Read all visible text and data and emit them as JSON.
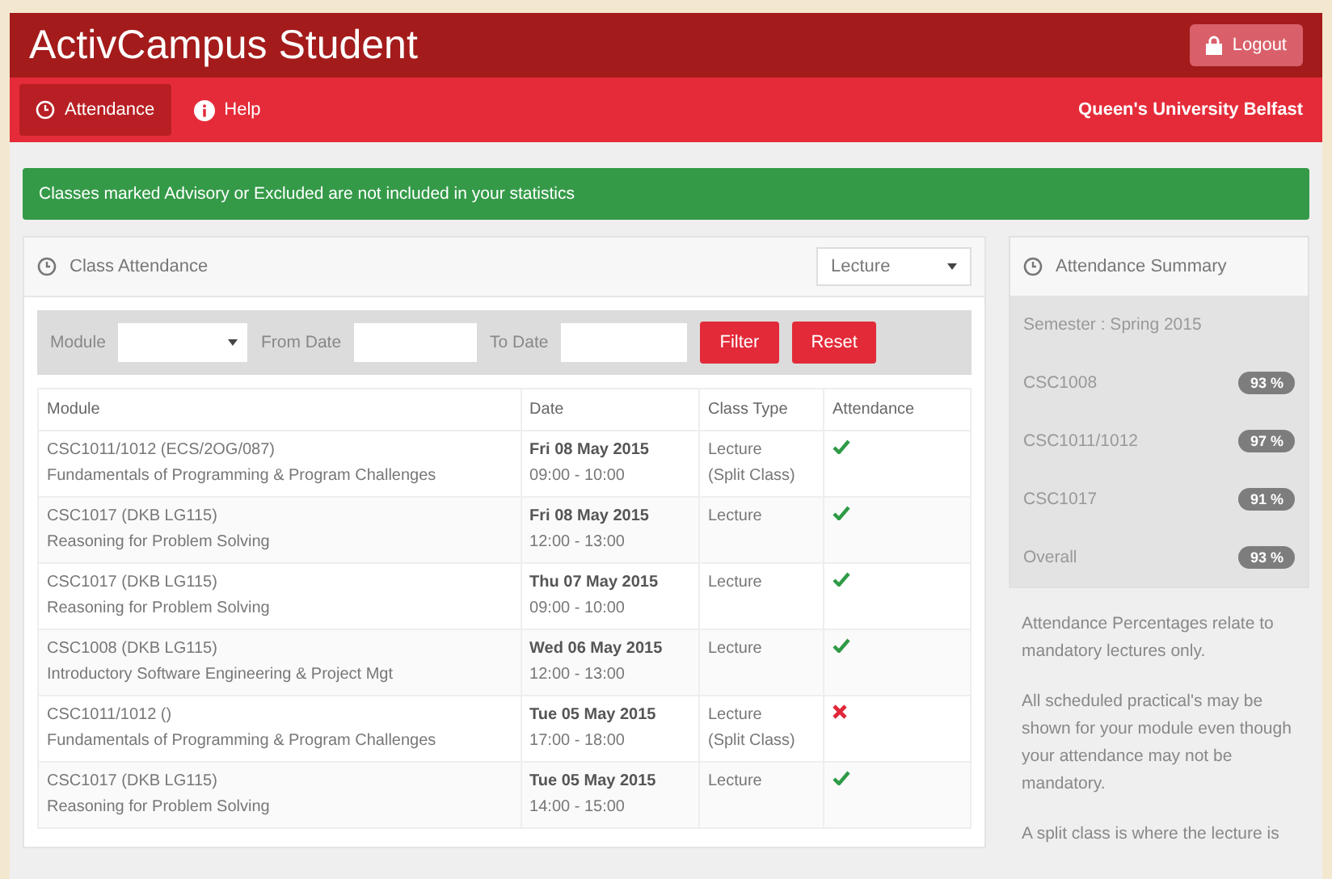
{
  "header": {
    "title": "ActivCampus Student",
    "logout": "Logout"
  },
  "nav": {
    "items": [
      {
        "label": "Attendance",
        "selected": true
      },
      {
        "label": "Help",
        "selected": false
      }
    ],
    "institution": "Queen's University Belfast"
  },
  "alert": "Classes marked Advisory or Excluded are not included in your statistics",
  "class_attendance": {
    "title": "Class Attendance",
    "type_select": "Lecture",
    "filters": {
      "module_label": "Module",
      "from_label": "From Date",
      "to_label": "To Date",
      "filter_button": "Filter",
      "reset_button": "Reset"
    },
    "columns": [
      "Module",
      "Date",
      "Class Type",
      "Attendance"
    ],
    "rows": [
      {
        "module": "CSC1011/1012 (ECS/2OG/087)",
        "name": "Fundamentals of Programming & Program Challenges",
        "date": "Fri 08 May 2015",
        "time": "09:00 - 10:00",
        "type": "Lecture",
        "note": "(Split Class)",
        "attended": true
      },
      {
        "module": "CSC1017 (DKB LG115)",
        "name": "Reasoning for Problem Solving",
        "date": "Fri 08 May 2015",
        "time": "12:00 - 13:00",
        "type": "Lecture",
        "attended": true
      },
      {
        "module": "CSC1017 (DKB LG115)",
        "name": "Reasoning for Problem Solving",
        "date": "Thu 07 May 2015",
        "time": "09:00 - 10:00",
        "type": "Lecture",
        "attended": true
      },
      {
        "module": "CSC1008 (DKB LG115)",
        "name": "Introductory Software Engineering & Project Mgt",
        "date": "Wed 06 May 2015",
        "time": "12:00 - 13:00",
        "type": "Lecture",
        "attended": true
      },
      {
        "module": "CSC1011/1012 ()",
        "name": "Fundamentals of Programming & Program Challenges",
        "date": "Tue 05 May 2015",
        "time": "17:00 - 18:00",
        "type": "Lecture",
        "note": "(Split Class)",
        "attended": false
      },
      {
        "module": "CSC1017 (DKB LG115)",
        "name": "Reasoning for Problem Solving",
        "date": "Tue 05 May 2015",
        "time": "14:00 - 15:00",
        "type": "Lecture",
        "attended": true
      }
    ]
  },
  "summary": {
    "title": "Attendance Summary",
    "semester": "Semester : Spring 2015",
    "items": [
      {
        "label": "CSC1008",
        "value": "93 %"
      },
      {
        "label": "CSC1011/1012",
        "value": "97 %"
      },
      {
        "label": "CSC1017",
        "value": "91 %"
      },
      {
        "label": "Overall",
        "value": "93 %"
      }
    ],
    "notes": [
      "Attendance Percentages relate to mandatory lectures only.",
      "All scheduled practical's may be shown for your module even though your attendance may not be mandatory.",
      "A split class is where the lecture is"
    ]
  }
}
